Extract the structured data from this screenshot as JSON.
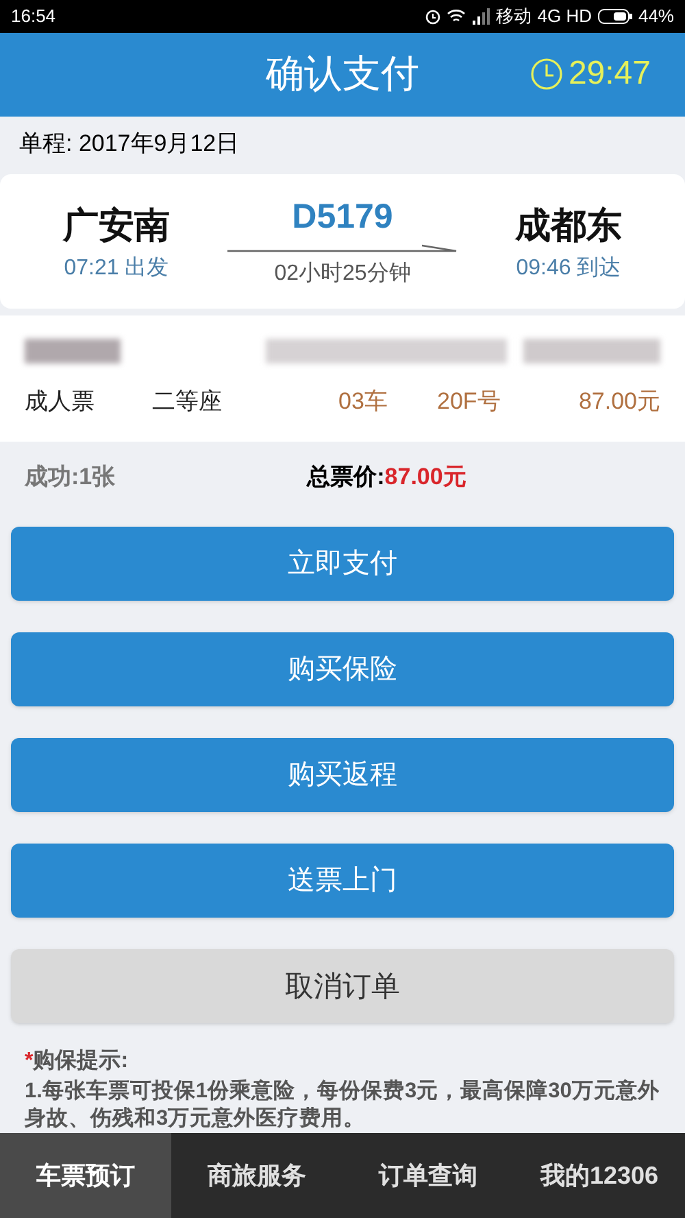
{
  "status_bar": {
    "time": "16:54",
    "carrier": "移动",
    "network": "4G HD",
    "battery": "44%"
  },
  "header": {
    "title": "确认支付",
    "countdown": "29:47"
  },
  "trip": {
    "type_date": "单程: 2017年9月12日",
    "from": "广安南",
    "depart": "07:21 出发",
    "train": "D5179",
    "duration": "02小时25分钟",
    "to": "成都东",
    "arrive": "09:46 到达"
  },
  "passenger": {
    "ticket_type": "成人票",
    "seat_class": "二等座",
    "car": "03车",
    "seat": "20F号",
    "price": "87.00元"
  },
  "summary": {
    "success": "成功:1张",
    "total_label": "总票价:",
    "total": "87.00元"
  },
  "buttons": [
    {
      "label": "立即支付",
      "kind": "primary"
    },
    {
      "label": "购买保险",
      "kind": "primary"
    },
    {
      "label": "购买返程",
      "kind": "primary"
    },
    {
      "label": "送票上门",
      "kind": "primary"
    },
    {
      "label": "取消订单",
      "kind": "secondary"
    }
  ],
  "notice": {
    "mark": "*",
    "title": "购保提示:",
    "text": "1.每张车票可投保1份乘意险，每份保费3元，最高保障30万元意外身故、伤残和3万元意外医疗费用。"
  },
  "tabs": [
    {
      "label": "车票预订",
      "selected": true
    },
    {
      "label": "商旅服务",
      "selected": false
    },
    {
      "label": "订单查询",
      "selected": false
    },
    {
      "label": "我的12306",
      "selected": false
    }
  ]
}
